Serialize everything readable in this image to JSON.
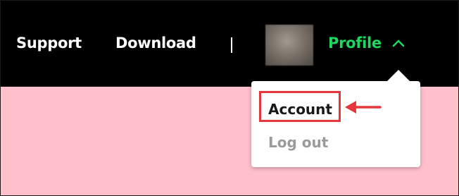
{
  "nav": {
    "support_label": "Support",
    "download_label": "Download"
  },
  "profile": {
    "label": "Profile",
    "icon": "chevron-up-icon",
    "avatar": "user-avatar-photo"
  },
  "dropdown": {
    "items": [
      {
        "label": "Account",
        "highlighted": true
      },
      {
        "label": "Log out",
        "highlighted": false
      }
    ]
  },
  "annotation": {
    "highlight_color": "#e5373c",
    "arrow_icon": "arrow-left-icon"
  },
  "colors": {
    "header_bg": "#000000",
    "content_bg": "#ffc0cb",
    "profile_accent": "#1ed760",
    "logout_text": "#9a9a9a"
  }
}
